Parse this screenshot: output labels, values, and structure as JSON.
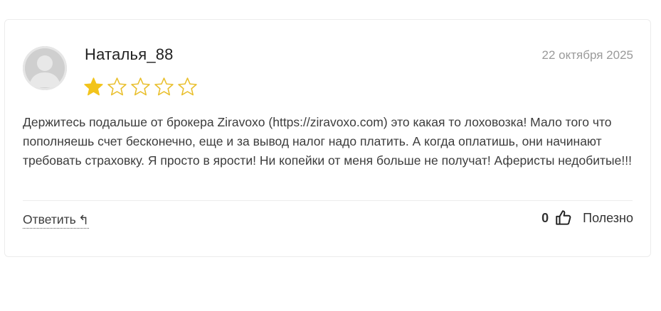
{
  "review": {
    "author": "Наталья_88",
    "date": "22 октября 2025",
    "rating": 1,
    "rating_max": 5,
    "text": "Держитесь подальше от брокера Ziravoxo (https://ziravoxo.com) это какая то лоховозка! Мало того что пополняешь счет бесконечно, еще и за вывод налог надо платить. А когда оплатишь, они начинают требовать страховку. Я просто в ярости! Ни копейки от меня больше не получат! Аферисты недобитые!!!"
  },
  "actions": {
    "reply_label": "Ответить",
    "reply_icon": "↰",
    "helpful_count": "0",
    "helpful_label": "Полезно"
  },
  "colors": {
    "star_filled": "#f2c41c",
    "star_outline": "#e9bf2c"
  },
  "icons": {
    "avatar": "user-avatar-placeholder",
    "star": "star-icon",
    "reply": "reply-arrow-icon",
    "thumb": "thumbs-up-icon"
  }
}
